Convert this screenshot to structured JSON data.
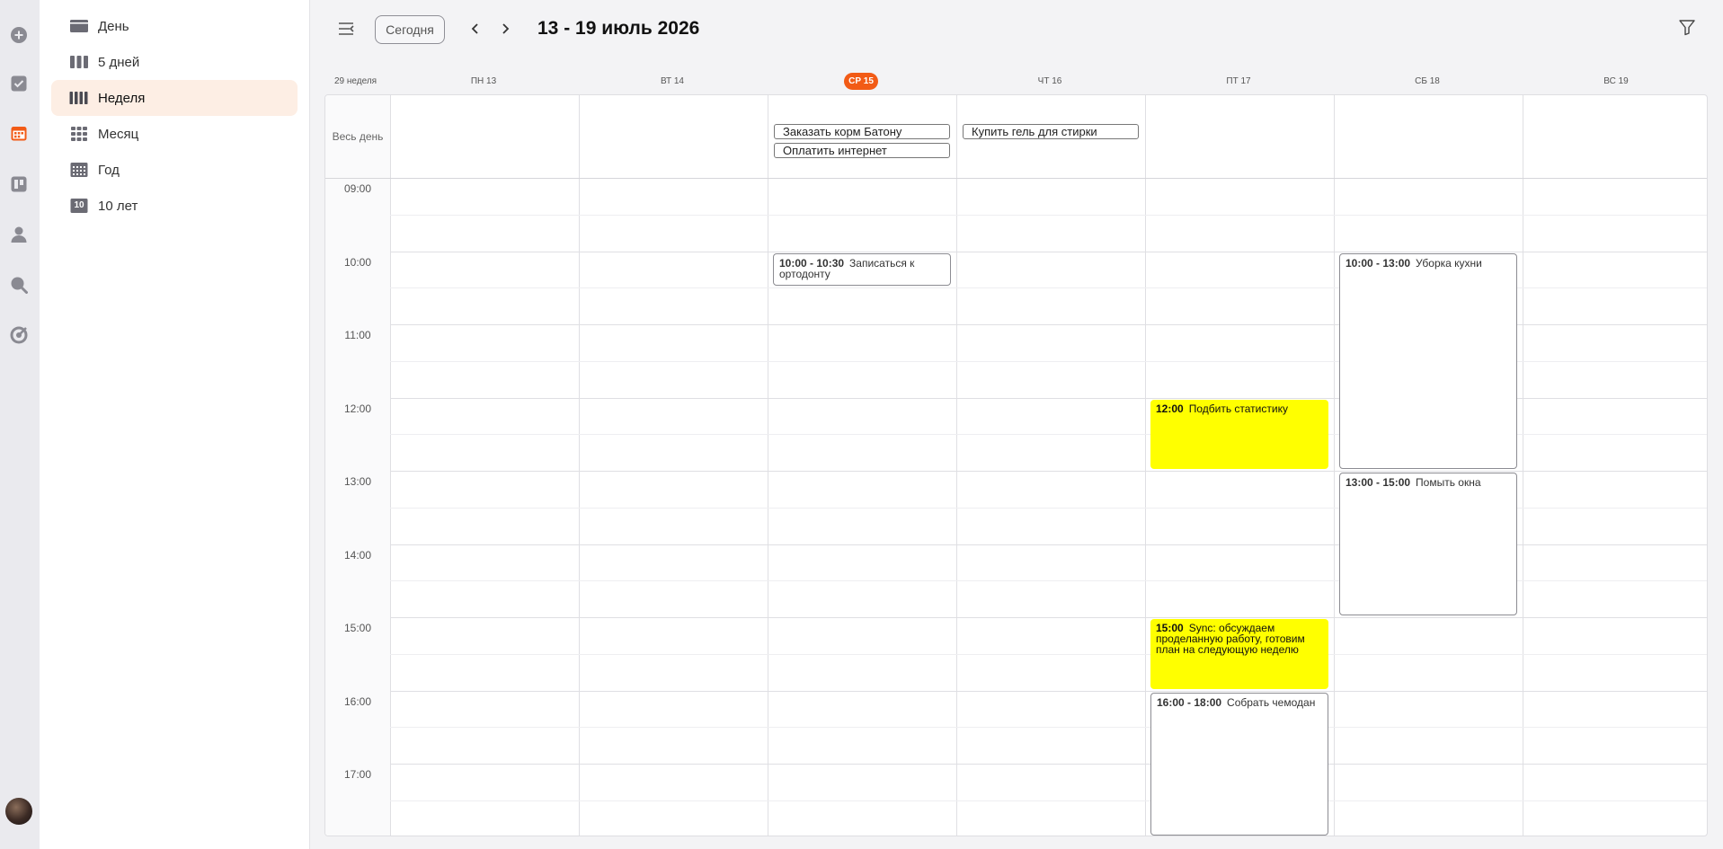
{
  "rail": {
    "icons": [
      "plus-circle-icon",
      "check-square-icon",
      "calendar-icon",
      "kanban-board-icon",
      "person-icon",
      "search-icon",
      "target-icon"
    ],
    "active_color": "#f25b16"
  },
  "views": [
    {
      "label": "День",
      "icon": "day-view-icon"
    },
    {
      "label": "5 дней",
      "icon": "five-day-view-icon"
    },
    {
      "label": "Неделя",
      "icon": "week-view-icon",
      "active": true
    },
    {
      "label": "Месяц",
      "icon": "month-view-icon"
    },
    {
      "label": "Год",
      "icon": "year-view-icon"
    },
    {
      "label": "10 лет",
      "icon": "decade-view-icon",
      "badge": "10"
    }
  ],
  "header": {
    "today_label": "Сегодня",
    "title": "13 - 19 июль 2026"
  },
  "week_label": "29 неделя",
  "days": [
    "ПН 13",
    "ВТ 14",
    "СР 15",
    "ЧТ 16",
    "ПТ 17",
    "СБ 18",
    "ВС 19"
  ],
  "today_index": 2,
  "allday_label": "Весь день",
  "hours": [
    "09:00",
    "10:00",
    "11:00",
    "12:00",
    "13:00",
    "14:00",
    "15:00",
    "16:00",
    "17:00"
  ],
  "allday_events": [
    {
      "day": 2,
      "row": 0,
      "title": "Заказать корм Батону"
    },
    {
      "day": 2,
      "row": 1,
      "title": "Оплатить интернет"
    },
    {
      "day": 3,
      "row": 0,
      "title": "Купить гель для стирки"
    }
  ],
  "events": [
    {
      "day": 2,
      "start": 10.0,
      "end": 10.5,
      "time": "10:00 - 10:30",
      "title": "Записаться к ортодонту",
      "style": "outline"
    },
    {
      "day": 4,
      "start": 12.0,
      "end": 13.0,
      "time": "12:00",
      "title": "Подбить статистику",
      "style": "yellow"
    },
    {
      "day": 4,
      "start": 15.0,
      "end": 16.0,
      "time": "15:00",
      "title": "Sync: обсуждаем проделанную работу, готовим план на следующую неделю",
      "style": "yellow"
    },
    {
      "day": 4,
      "start": 16.0,
      "end": 18.0,
      "time": "16:00 - 18:00",
      "title": "Собрать чемодан",
      "style": "outline"
    },
    {
      "day": 5,
      "start": 10.0,
      "end": 13.0,
      "time": "10:00 - 13:00",
      "title": "Уборка кухни",
      "style": "outline"
    },
    {
      "day": 5,
      "start": 13.0,
      "end": 15.0,
      "time": "13:00 - 15:00",
      "title": "Помыть окна",
      "style": "outline"
    }
  ],
  "colors": {
    "accent": "#f25b16",
    "event_yellow": "#ffff00",
    "active_view_bg": "#fdeee4"
  }
}
